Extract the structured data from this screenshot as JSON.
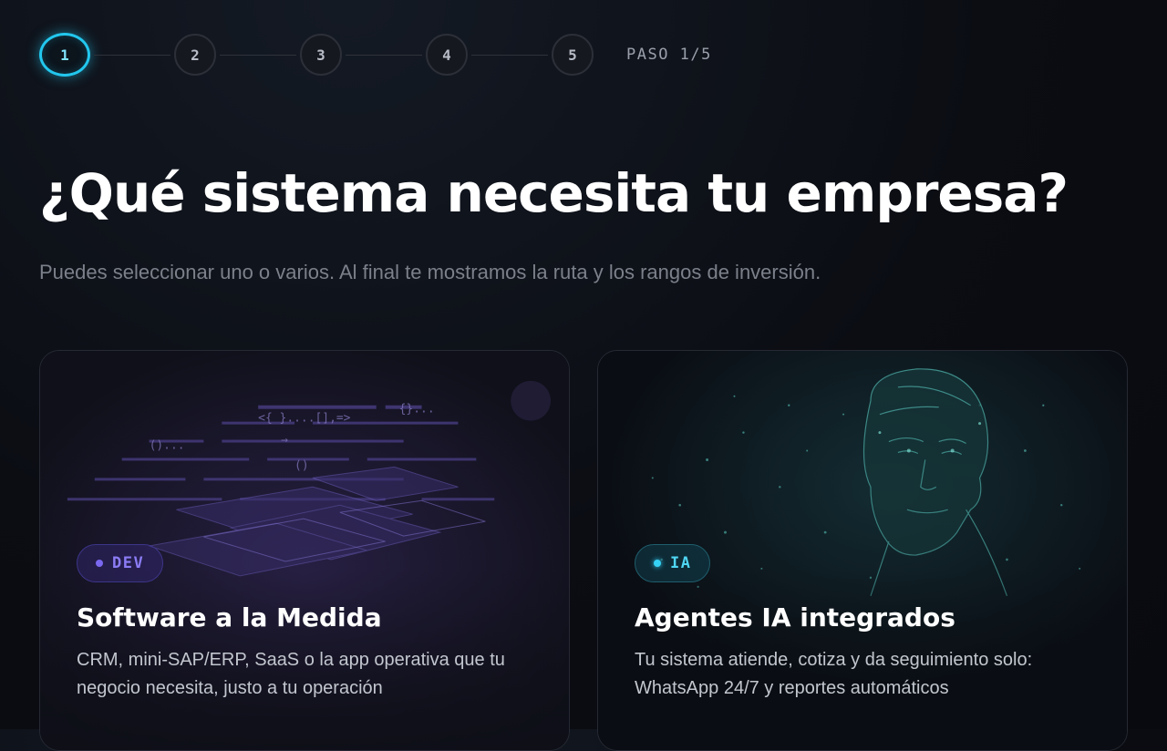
{
  "stepper": {
    "steps": [
      {
        "label": "1",
        "state": "active"
      },
      {
        "label": "2",
        "state": "inactive"
      },
      {
        "label": "3",
        "state": "inactive"
      },
      {
        "label": "4",
        "state": "inactive"
      },
      {
        "label": "5",
        "state": "inactive"
      }
    ],
    "progress_label": "PASO 1/5",
    "accent_color": "#22c7ee"
  },
  "header": {
    "title": "¿Qué sistema necesita tu empresa?",
    "subtitle": "Puedes seleccionar uno o varios. Al final te mostramos la ruta y los rangos de inversión."
  },
  "cards": [
    {
      "badge": "DEV",
      "title": "Software a la Medida",
      "description": "CRM, mini-SAP/ERP, SaaS o la app operativa que tu negocio necesita, justo a tu operación",
      "image_icon": "code-screens-illustration",
      "badge_color": "#8b7cf5",
      "code_snippets": [
        "<{ }....[],=>",
        "{}...",
        "()...",
        "→",
        "()"
      ]
    },
    {
      "badge": "IA",
      "title": "Agentes IA integrados",
      "description": "Tu sistema atiende, cotiza y da seguimiento solo: WhatsApp 24/7 y reportes automáticos",
      "image_icon": "ai-head-illustration",
      "badge_color": "#4fd6f2"
    }
  ]
}
